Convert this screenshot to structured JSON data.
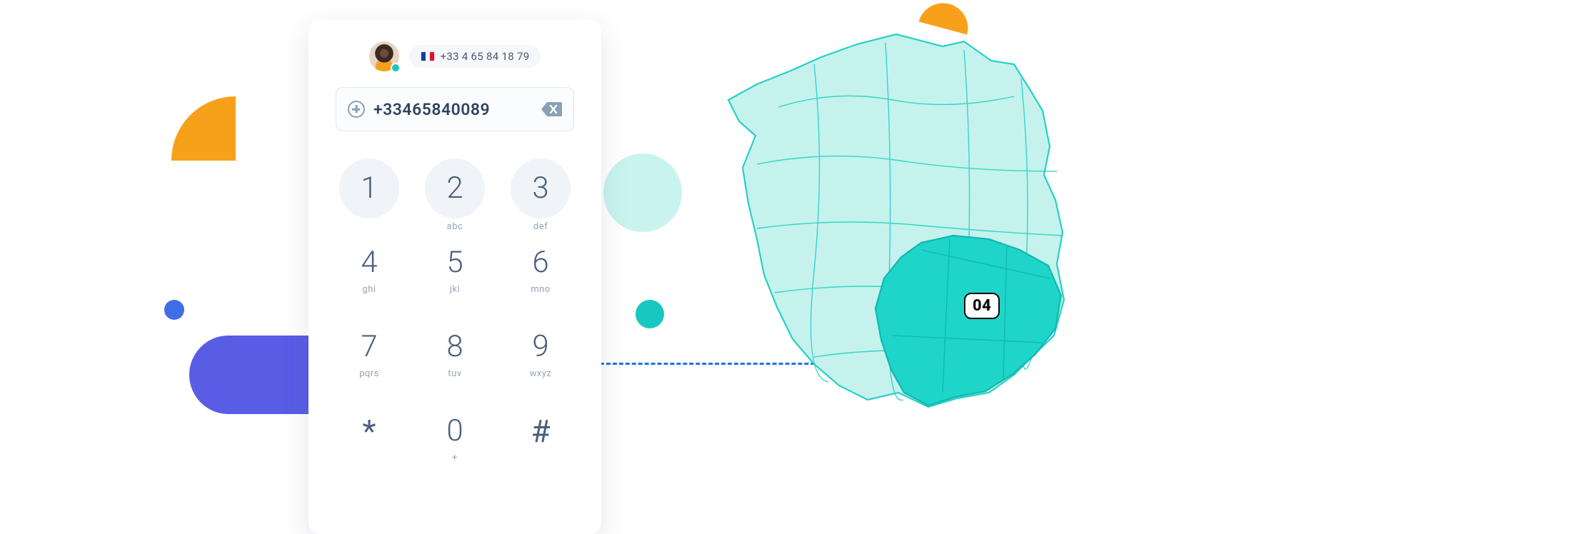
{
  "header": {
    "displayed_number": "+33 4 65 84 18 79"
  },
  "number_field": {
    "value": "+33465840089"
  },
  "keypad": {
    "keys": [
      {
        "digit": "1",
        "letters": ""
      },
      {
        "digit": "2",
        "letters": "abc"
      },
      {
        "digit": "3",
        "letters": "def"
      },
      {
        "digit": "4",
        "letters": "ghi"
      },
      {
        "digit": "5",
        "letters": "jkl"
      },
      {
        "digit": "6",
        "letters": "mno"
      },
      {
        "digit": "7",
        "letters": "pqrs"
      },
      {
        "digit": "8",
        "letters": "tuv"
      },
      {
        "digit": "9",
        "letters": "wxyz"
      },
      {
        "digit": "*",
        "letters": ""
      },
      {
        "digit": "0",
        "letters": "+"
      },
      {
        "digit": "#",
        "letters": ""
      }
    ]
  },
  "map": {
    "region_badge": "04"
  },
  "colors": {
    "accent_teal": "#17c8c0",
    "map_light": "#c5f2ed",
    "map_highlight": "#1fd4c8",
    "map_stroke": "#27d0c6",
    "indigo": "#595de5",
    "orange": "#f7a11b",
    "blue": "#3f6ee8"
  }
}
